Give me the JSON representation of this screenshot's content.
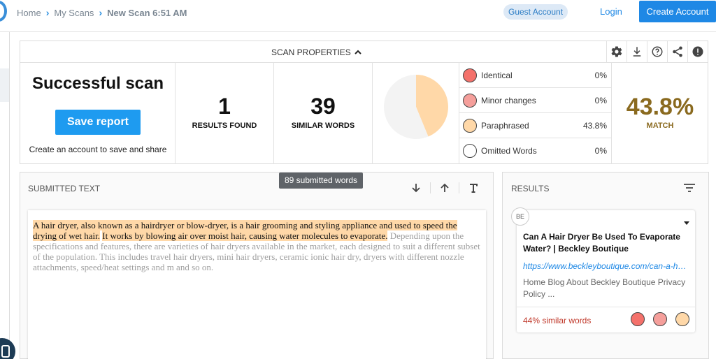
{
  "breadcrumb": {
    "home": "Home",
    "scans": "My Scans",
    "current": "New Scan 6:51 AM"
  },
  "header": {
    "guest_badge": "Guest Account",
    "login": "Login",
    "create_account": "Create Account"
  },
  "scan_properties": {
    "title": "SCAN PROPERTIES",
    "status_title": "Successful scan",
    "save_report": "Save report",
    "status_hint": "Create an account to save and share",
    "results_found": {
      "value": "1",
      "label": "RESULTS FOUND"
    },
    "similar_words": {
      "value": "39",
      "label": "SIMILAR WORDS"
    },
    "match": {
      "value": "43.8%",
      "label": "MATCH"
    }
  },
  "legend": [
    {
      "label": "Identical",
      "value": "0%",
      "color": "#f4716b"
    },
    {
      "label": "Minor changes",
      "value": "0%",
      "color": "#f59f9b"
    },
    {
      "label": "Paraphrased",
      "value": "43.8%",
      "color": "#ffd8a8"
    },
    {
      "label": "Omitted Words",
      "value": "0%",
      "color": "#ffffff"
    }
  ],
  "chart_data": {
    "type": "pie",
    "categories": [
      "Paraphrased",
      "Other"
    ],
    "values": [
      43.8,
      56.2
    ],
    "colors": [
      "#ffd8a8",
      "#f3f3f3"
    ]
  },
  "submitted": {
    "title": "SUBMITTED TEXT",
    "word_count_tip": "89 submitted words",
    "highlighted_1": "A hair dryer, also known as a hairdryer or blow-dryer, is a hair grooming and styling appliance and used to speed the drying of wet hair.",
    "highlighted_2": "It works by blowing air over moist hair, causing water molecules to evaporate.",
    "plain": "Depending upon the specifications and features, there are varieties of hair dryers available in the market, each designed to suit a different subset of the population. This includes travel hair dryers, mini hair dryers, ceramic ionic hair dry, dryers with different nozzle attachments, speed/heat settings and m and so on."
  },
  "results": {
    "title": "RESULTS",
    "card": {
      "avatar": "BE",
      "heading": "Can A Hair Dryer Be Used To Evaporate Water? | Beckley Boutique",
      "url": "https://www.beckleyboutique.com/can-a-hair-dryer-be-used-to-evaporate-water",
      "snippet": "Home Blog About Beckley Boutique Privacy Policy ...",
      "similar": "44% similar words",
      "dot_colors": [
        "#f4716b",
        "#f59f9b",
        "#ffd8a8"
      ]
    }
  }
}
